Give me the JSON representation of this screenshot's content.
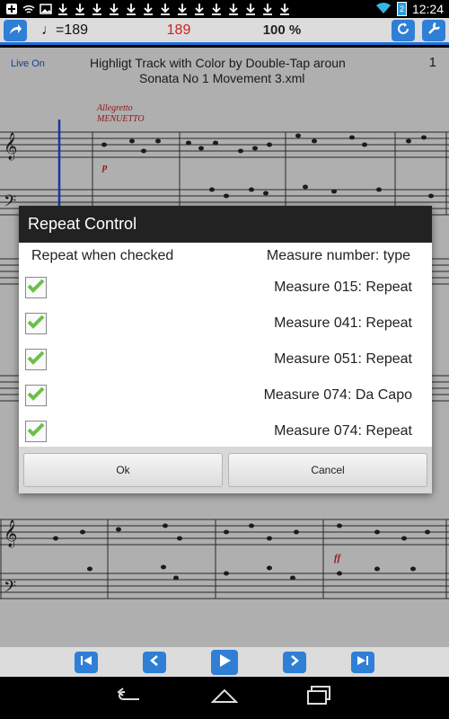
{
  "status": {
    "time": "12:24",
    "battery": "2"
  },
  "toolbar": {
    "tempo": "♩=189",
    "beat_value": "189",
    "zoom": "100 %"
  },
  "score": {
    "live_label": "Live On",
    "title_line1": "Highligt Track with Color by Double-Tap aroun",
    "title_line2": "Sonata No 1 Movement 3.xml",
    "page_number": "1",
    "tempo_text": "Allegretto",
    "style_text": "MENUETTO",
    "dynamic_p": "p",
    "dynamic_ff": "ff"
  },
  "dialog": {
    "title": "Repeat Control",
    "col_left": "Repeat when checked",
    "col_right": "Measure number: type",
    "rows": [
      {
        "label": "Measure 015: Repeat",
        "checked": true
      },
      {
        "label": "Measure 041: Repeat",
        "checked": true
      },
      {
        "label": "Measure 051: Repeat",
        "checked": true
      },
      {
        "label": "Measure 074: Da Capo",
        "checked": true
      },
      {
        "label": "Measure 074: Repeat",
        "checked": true
      }
    ],
    "ok_label": "Ok",
    "cancel_label": "Cancel"
  },
  "colors": {
    "accent": "#2f7fd6",
    "check": "#6cc04a",
    "dialog_title_bg": "#222222"
  }
}
